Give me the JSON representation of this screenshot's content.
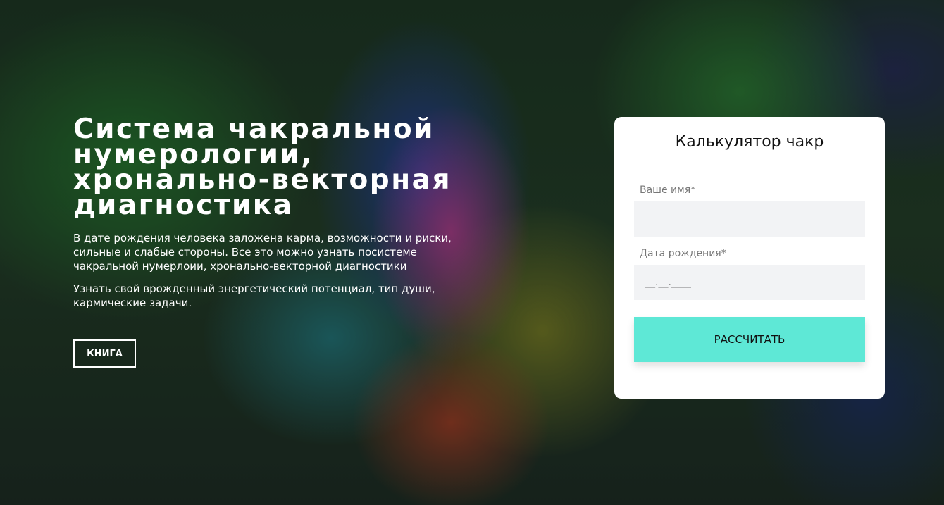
{
  "hero": {
    "title_lines": [
      "Система чакральной",
      "нумерологии,",
      "хронально-векторная",
      "диагностика"
    ],
    "lead": "В дате рождения человека заложена карма, возможности и риски, сильные и слабые стороны. Все это можно узнать посистеме чакральной нумерлоии, хронально-векторной диагностики",
    "lead2": "Узнать свой врожденный энергетический потенциал, тип души, кармические задачи.",
    "book_button": "КНИГА"
  },
  "calculator": {
    "title": "Калькулятор чакр",
    "name_label": "Ваше имя*",
    "name_value": "",
    "date_label": "Дата рождения*",
    "date_placeholder": "__.__.____",
    "submit_label": "РАССЧИТАТЬ"
  },
  "colors": {
    "accent": "#5ee8d6",
    "card_background": "#ffffff",
    "input_background": "#f2f3f5",
    "hero_text": "#ffffff"
  }
}
